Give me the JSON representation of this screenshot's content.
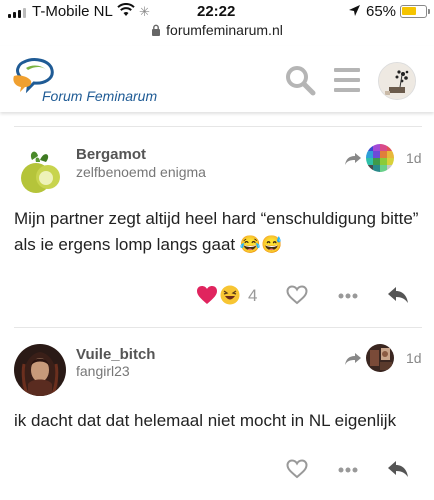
{
  "status_bar": {
    "carrier": "T-Mobile NL",
    "time": "22:22",
    "battery_percent": "65%",
    "battery_level": 0.65
  },
  "url_bar": {
    "url": "forumfeminarum.nl"
  },
  "site": {
    "logo_text": "Forum Feminarum",
    "icons": [
      "search-icon",
      "hamburger-menu-icon",
      "user-avatar"
    ]
  },
  "posts": [
    {
      "username": "Bergamot",
      "user_title": "zelfbenoemd enigma",
      "date": "1d",
      "body": "Mijn partner zegt altijd heel hard “enschuldigung bitte” als ie ergens lomp langs gaat 😂😅",
      "reactions": [
        "heart",
        "laughing-face"
      ],
      "like_count": "4",
      "actions": [
        "like-icon",
        "more-icon",
        "reply-icon"
      ]
    },
    {
      "username": "Vuile_bitch",
      "user_title": "fangirl23",
      "date": "1d",
      "body": "ik dacht dat dat helemaal niet mocht in NL eigenlijk",
      "actions": [
        "like-icon",
        "more-icon",
        "reply-icon"
      ]
    }
  ],
  "colors": {
    "logo_blue": "#1f5b95",
    "logo_orange": "#f0a030",
    "logo_green": "#7cb342",
    "heart_red": "#e0245e",
    "muted_gray": "#999999"
  }
}
